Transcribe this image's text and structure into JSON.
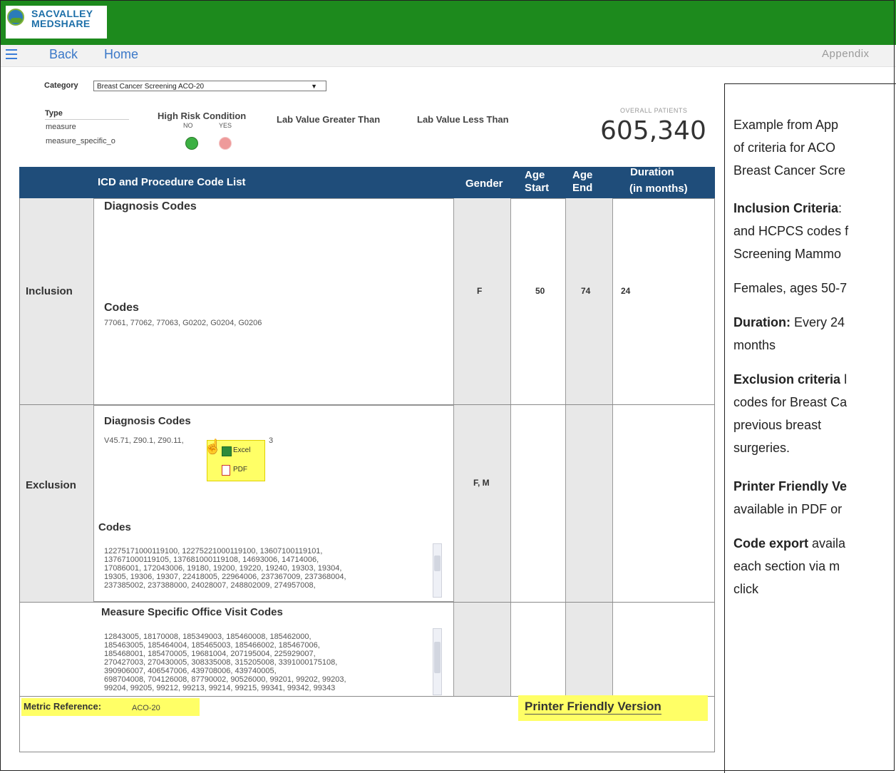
{
  "brand": {
    "line1": "SACVALLEY",
    "line2": "MEDSHARE"
  },
  "nav": {
    "back": "Back",
    "home": "Home",
    "appendix": "Appendix"
  },
  "filters": {
    "category_label": "Category",
    "category_value": "Breast Cancer Screening ACO-20",
    "type_label": "Type",
    "type_values": [
      "measure",
      "measure_specific_o"
    ],
    "high_risk_label": "High Risk Condition",
    "no_label": "NO",
    "yes_label": "YES",
    "lab_greater": "Lab Value Greater Than",
    "lab_less": "Lab Value Less Than"
  },
  "overall": {
    "label": "OVERALL PATIENTS",
    "value": "605,340"
  },
  "table": {
    "headers": {
      "codes": "ICD and Procedure Code List",
      "gender": "Gender",
      "age_start_1": "Age",
      "age_start_2": "Start",
      "age_end_1": "Age",
      "age_end_2": "End",
      "duration_1": "Duration",
      "duration_2": "(in months)"
    },
    "inclusion": {
      "label": "Inclusion",
      "diag_title": "Diagnosis Codes",
      "codes_title": "Codes",
      "codes": "77061, 77062, 77063, G0202, G0204, G0206",
      "gender": "F",
      "age_start": "50",
      "age_end": "74",
      "duration": "24"
    },
    "exclusion": {
      "label": "Exclusion",
      "diag_title": "Diagnosis Codes",
      "diag_codes": "V45.71, Z90.1, Z90.11,",
      "diag_tail": "3",
      "codes_title": "Codes",
      "codes_lines": [
        "12275171000119100, 12275221000119100, 13607100119101,",
        "137671000119105, 137681000119108, 14693006, 14714006,",
        "17086001, 172043006, 19180, 19200, 19220, 19240, 19303, 19304,",
        "19305, 19306, 19307, 22418005, 22964006, 237367009, 237368004,",
        "237385002, 237388000, 24028007, 248802009, 274957008,"
      ],
      "gender": "F, M"
    },
    "office": {
      "title": "Measure Specific Office Visit Codes",
      "codes_lines": [
        "12843005, 18170008, 185349003, 185460008, 185462000,",
        "185463005, 185464004, 185465003, 185466002, 185467006,",
        "185468001, 185470005, 19681004, 207195004, 225929007,",
        "270427003, 270430005, 308335008, 315205008, 3391000175108,",
        "390906007, 406547006, 439708006, 439740005,",
        "698704008, 704126008, 87790002, 90526000, 99201, 99202, 99203,",
        "99204, 99205, 99212, 99213, 99214, 99215, 99341, 99342, 99343"
      ]
    },
    "metric_label": "Metric Reference:",
    "metric_value": "ACO-20",
    "printer": "Printer Friendly Version"
  },
  "popup": {
    "excel": "Excel",
    "pdf": "PDF"
  },
  "annotation": {
    "l1": "Example from App",
    "l2": "of criteria for ACO",
    "l3": "Breast Cancer Scre",
    "l4b": "Inclusion Criteria",
    "l4": ":",
    "l5": "and HCPCS codes f",
    "l6": "Screening Mammo",
    "l7": "Females, ages 50-7",
    "l8b": "Duration:",
    "l8": " Every 24",
    "l9": "months",
    "l10b": "Exclusion criteria",
    "l10": " l",
    "l11": "codes for Breast Ca",
    "l12": "previous breast",
    "l13": "surgeries.",
    "l14b": "Printer Friendly Ve",
    "l15": "available in PDF or",
    "l16b": "Code export",
    "l16": " availa",
    "l17": "each section via m",
    "l18": "click"
  },
  "colors": {
    "topbar": "#1d8a1d",
    "table_header": "#1f4d7a",
    "highlight": "#ffff66",
    "link": "#3b78c8"
  }
}
